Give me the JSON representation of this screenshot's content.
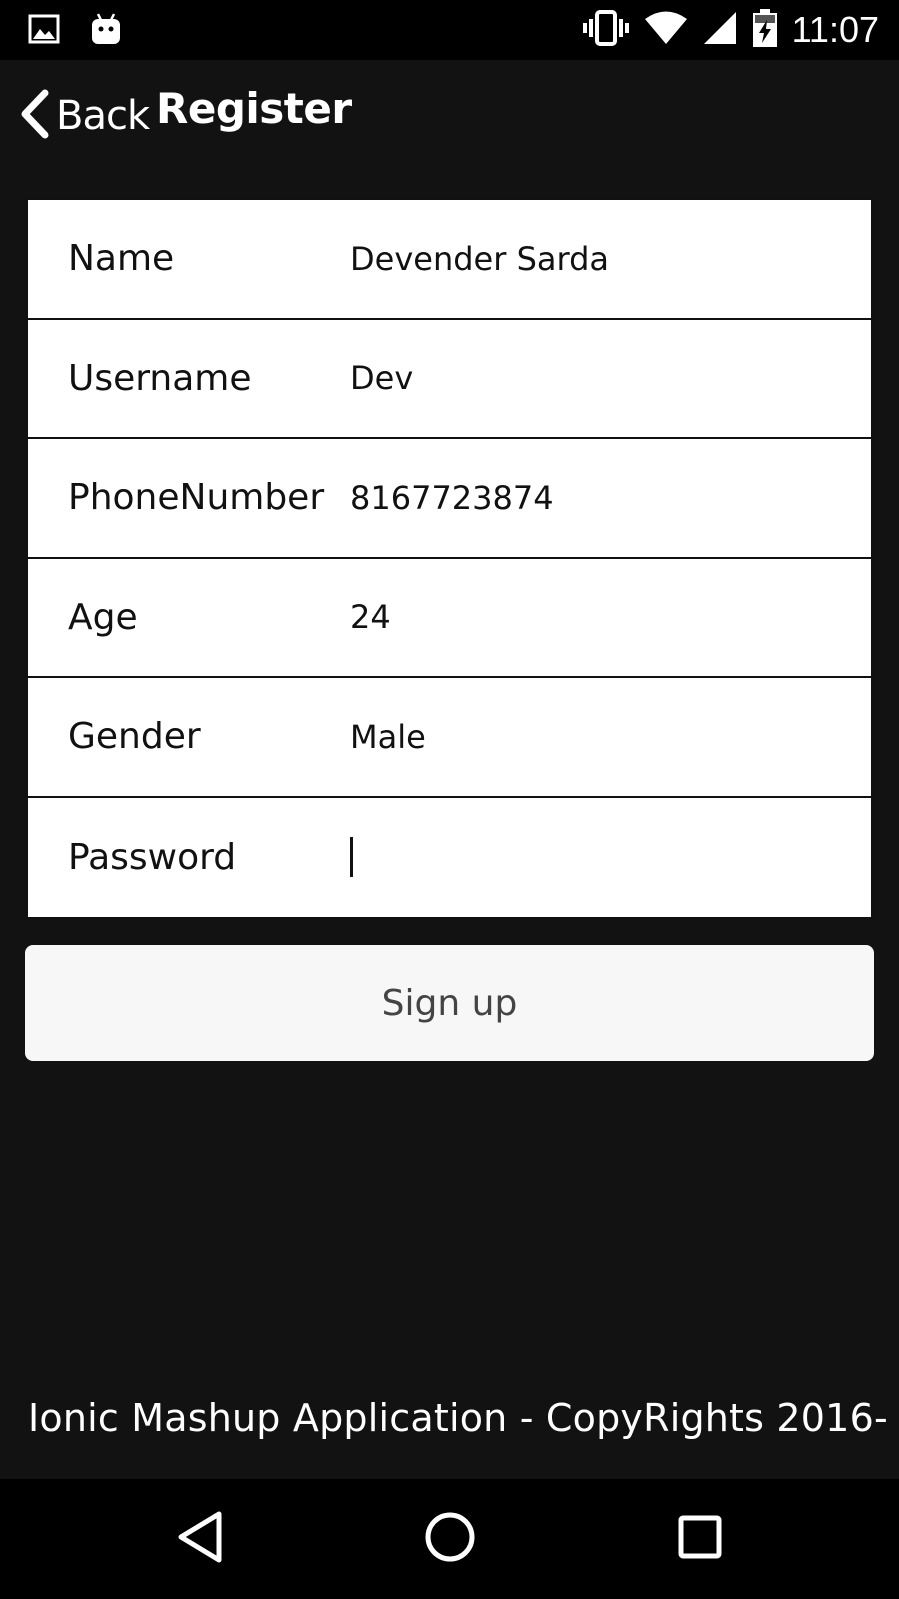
{
  "status_bar": {
    "left_icons": [
      "image-icon",
      "android-icon"
    ],
    "right_icons": [
      "vibrate-icon",
      "wifi-icon",
      "cell-signal-icon",
      "battery-charging-icon"
    ],
    "time": "11:07"
  },
  "header": {
    "back_label": "Back",
    "title": "Register"
  },
  "form": {
    "fields": [
      {
        "label": "Name",
        "value": "Devender Sarda"
      },
      {
        "label": "Username",
        "value": "Dev"
      },
      {
        "label": "PhoneNumber",
        "value": "8167723874"
      },
      {
        "label": "Age",
        "value": "24"
      },
      {
        "label": "Gender",
        "value": "Male"
      },
      {
        "label": "Password",
        "value": ""
      }
    ]
  },
  "signup_label": "Sign up",
  "footer": {
    "text": "Ionic Mashup Application - CopyRights 2016-"
  },
  "nav_bar": {
    "icons": [
      "back-triangle-icon",
      "home-circle-icon",
      "recents-square-icon"
    ]
  },
  "colors": {
    "background": "#121212",
    "card": "#ffffff",
    "button": "#f7f7f7"
  }
}
